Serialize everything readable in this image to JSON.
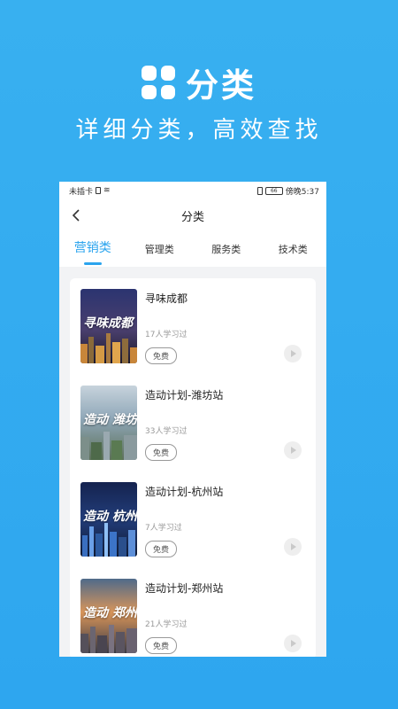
{
  "promo": {
    "title": "分类",
    "subtitle": "详细分类，高效查找"
  },
  "status_bar": {
    "carrier": "未插卡",
    "battery": "66",
    "time": "傍晚5:37"
  },
  "nav": {
    "title": "分类"
  },
  "tabs": [
    {
      "label": "营销类",
      "active": true
    },
    {
      "label": "管理类",
      "active": false
    },
    {
      "label": "服务类",
      "active": false
    },
    {
      "label": "技术类",
      "active": false
    }
  ],
  "courses": [
    {
      "title": "寻味成都",
      "learners": "17人学习过",
      "badge": "免费",
      "thumb_text": "寻味成都",
      "thumb_bg": "#3a3f6b"
    },
    {
      "title": "造动计划-潍坊站",
      "learners": "33人学习过",
      "badge": "免费",
      "thumb_text": "造动 潍坊",
      "thumb_bg": "#6d8fa8"
    },
    {
      "title": "造动计划-杭州站",
      "learners": "7人学习过",
      "badge": "免费",
      "thumb_text": "造动 杭州",
      "thumb_bg": "#1c2f66"
    },
    {
      "title": "造动计划-郑州站",
      "learners": "21人学习过",
      "badge": "免费",
      "thumb_text": "造动 郑州",
      "thumb_bg": "#c98a5a"
    }
  ],
  "colors": {
    "accent": "#2ba4ee",
    "background": "#38b0f0"
  }
}
